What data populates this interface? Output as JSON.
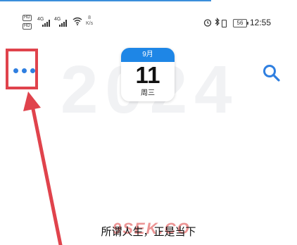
{
  "status_bar": {
    "sim1": "HD",
    "sim2": "HD",
    "net1": "4G",
    "net2": "4G",
    "speed_value": "8",
    "speed_unit": "K/s",
    "battery": "56",
    "time": "12:55"
  },
  "watermark_year": "2024",
  "calendar": {
    "month": "9月",
    "day": "11",
    "weekday": "周三"
  },
  "tagline": "所谓人生，正是当下",
  "watermark": "9SEK.CO",
  "colors": {
    "accent": "#1e86e6",
    "annotation": "#e0434c"
  },
  "icons": {
    "more": "more-dots-icon",
    "search": "search-icon",
    "alarm": "alarm-icon",
    "bluetooth": "bluetooth-icon",
    "wifi": "wifi-icon"
  }
}
